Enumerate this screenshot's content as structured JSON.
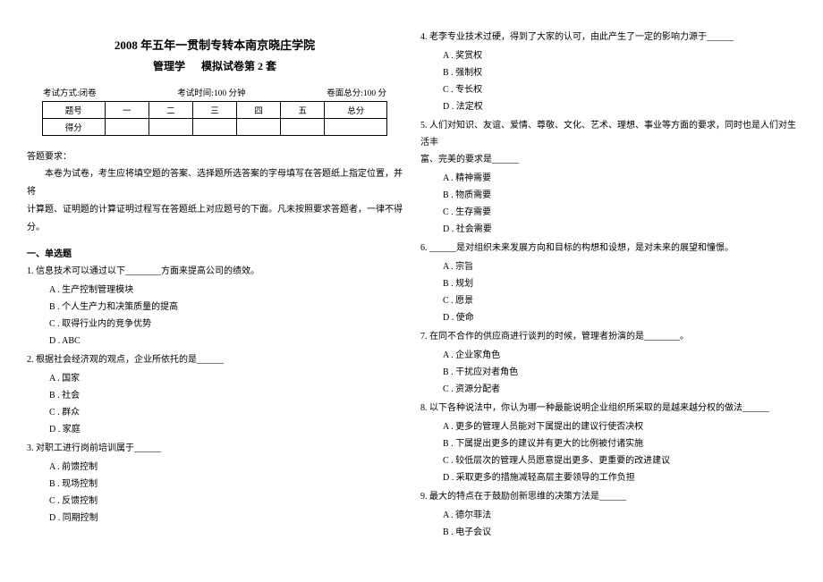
{
  "header": {
    "title_line1": "2008 年五年一贯制专转本南京晓庄学院",
    "title_line2_a": "管理学",
    "title_line2_b": "模拟试卷第 2 套"
  },
  "meta": {
    "mode_label": "考试方式:闭卷",
    "time_label": "考试时间:100 分钟",
    "total_label": "卷面总分:100 分"
  },
  "score_table": {
    "row1": [
      "题号",
      "一",
      "二",
      "三",
      "四",
      "五",
      "总分"
    ],
    "row2_label": "得分"
  },
  "req_label": "答题要求：",
  "instructions_l1": "本卷为试卷，考生应将填空题的答案、选择题所选答案的字母填写在答题纸上指定位置，并将",
  "instructions_l2": "计算题、证明题的计算证明过程写在答题纸上对应题号的下面。凡未按照要求答题者，一律不得分。",
  "sec1": "一、单选题",
  "q1": {
    "stem": "1. 信息技术可以通过以下________方面来提高公司的绩效。",
    "A": "A . 生产控制管理模块",
    "B": "B . 个人生产力和决策质量的提高",
    "C": "C . 取得行业内的竞争优势",
    "D": "D . ABC"
  },
  "q2": {
    "stem": "2. 根据社会经济观的观点，企业所依托的是______",
    "A": "A . 国家",
    "B": "B . 社会",
    "C": "C . 群众",
    "D": "D . 家庭"
  },
  "q3": {
    "stem": "3. 对职工进行岗前培训属于______",
    "A": "A . 前馈控制",
    "B": "B . 现场控制",
    "C": "C . 反馈控制",
    "D": "D . 同期控制"
  },
  "q4": {
    "stem": "4. 老李专业技术过硬，得到了大家的认可，由此产生了一定的影响力源于______",
    "A": "A . 奖赏权",
    "B": "B . 强制权",
    "C": "C . 专长权",
    "D": "D . 法定权"
  },
  "q5": {
    "stem_l1": "5. 人们对知识、友谊、爱情、尊敬、文化、艺术、理想、事业等方面的要求，同时也是人们对生活丰",
    "stem_l2": "富、完美的要求是______",
    "A": "A . 精神需要",
    "B": "B . 物质需要",
    "C": "C . 生存需要",
    "D": "D . 社会需要"
  },
  "q6": {
    "stem": "6. ______是对组织未来发展方向和目标的构想和设想，是对未来的展望和憧憬。",
    "A": "A . 宗旨",
    "B": "B . 规划",
    "C": "C . 愿景",
    "D": "D . 使命"
  },
  "q7": {
    "stem": "7. 在同不合作的供应商进行谈判的时候，管理者扮演的是________。",
    "A": "A . 企业家角色",
    "B": "B . 干扰应对者角色",
    "C": "C . 资源分配者"
  },
  "q8": {
    "stem": "8. 以下各种说法中，你认为哪一种最能说明企业组织所采取的是越来越分权的做法______",
    "A": "A . 更多的管理人员能对下属提出的建议行使否决权",
    "B": "B . 下属提出更多的建议并有更大的比例被付诸实施",
    "C": "C . 较低层次的管理人员愿意提出更多、更重要的改进建议",
    "D": "D . 采取更多的措施减轻高层主要领导的工作负担"
  },
  "q9": {
    "stem": "9. 最大的特点在于鼓励创新思维的决策方法是______",
    "A": "A . 德尔菲法",
    "B": "B . 电子会议"
  }
}
